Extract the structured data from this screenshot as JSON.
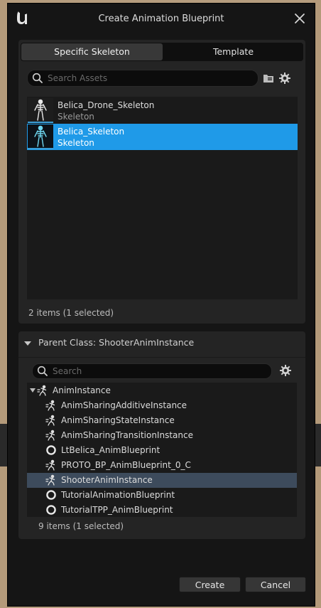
{
  "dialog": {
    "title": "Create Animation Blueprint"
  },
  "tabs": [
    {
      "label": "Specific Skeleton",
      "active": true
    },
    {
      "label": "Template",
      "active": false
    }
  ],
  "asset_picker": {
    "search_placeholder": "Search Assets",
    "items": [
      {
        "name": "Belica_Drone_Skeleton",
        "type": "Skeleton",
        "selected": false
      },
      {
        "name": "Belica_Skeleton",
        "type": "Skeleton",
        "selected": true
      }
    ],
    "status": "2 items (1 selected)"
  },
  "parent_class": {
    "header": "Parent Class: ShooterAnimInstance",
    "search_placeholder": "Search",
    "tree": [
      {
        "label": "AnimInstance",
        "icon": "anim-instance-icon",
        "level": 0,
        "expanded": true,
        "selected": false
      },
      {
        "label": "AnimSharingAdditiveInstance",
        "icon": "anim-instance-icon",
        "level": 1,
        "selected": false
      },
      {
        "label": "AnimSharingStateInstance",
        "icon": "anim-instance-icon",
        "level": 1,
        "selected": false
      },
      {
        "label": "AnimSharingTransitionInstance",
        "icon": "anim-instance-icon",
        "level": 1,
        "selected": false
      },
      {
        "label": "LtBelica_AnimBlueprint",
        "icon": "blueprint-circle-icon",
        "level": 1,
        "selected": false
      },
      {
        "label": "PROTO_BP_AnimBlueprint_0_C",
        "icon": "anim-instance-icon",
        "level": 1,
        "selected": false
      },
      {
        "label": "ShooterAnimInstance",
        "icon": "anim-instance-icon",
        "level": 1,
        "selected": true
      },
      {
        "label": "TutorialAnimationBlueprint",
        "icon": "blueprint-circle-icon",
        "level": 1,
        "selected": false
      },
      {
        "label": "TutorialTPP_AnimBlueprint",
        "icon": "blueprint-circle-icon",
        "level": 1,
        "selected": false
      }
    ],
    "status": "9 items (1 selected)"
  },
  "buttons": {
    "create": "Create",
    "cancel": "Cancel"
  },
  "colors": {
    "selection_blue": "#1f9ae8",
    "tree_selection": "#3d4b5c",
    "dialog_bg": "#151515",
    "panel_bg": "#242424"
  }
}
